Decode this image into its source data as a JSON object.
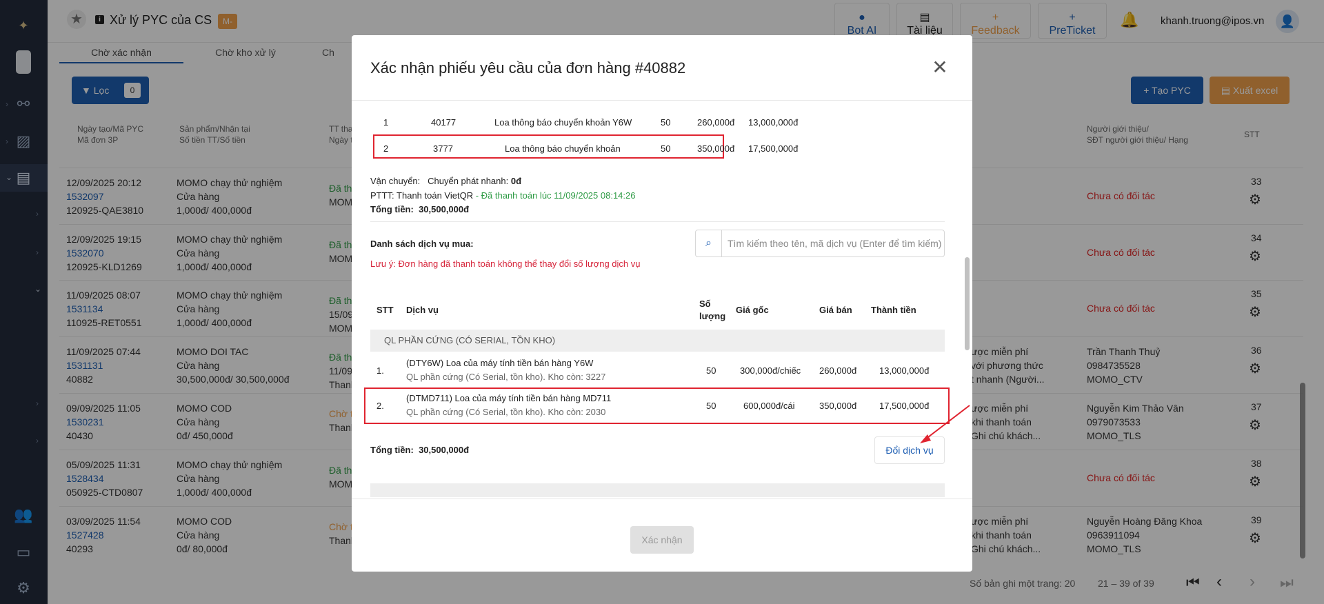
{
  "app": {
    "title": "Xử lý PYC của CS",
    "badge": "M-"
  },
  "topbar": {
    "bot_ai": "Bot AI",
    "tai_lieu": "Tài liệu",
    "feedback": "Feedback",
    "preticket": "PreTicket",
    "user_email": "khanh.truong@ipos.vn"
  },
  "tabs": [
    "Chờ xác nhận",
    "Chờ kho xử lý",
    "Ch"
  ],
  "filter": {
    "label": "Lọc",
    "count": "0"
  },
  "actions": {
    "create": "+ Tạo PYC",
    "excel": "Xuất excel"
  },
  "table": {
    "headers": {
      "col1": "Ngày tạo/Mã PYC\nMã đơn 3P",
      "col2": "Sản phẩm/Nhận tại\nSố tiền TT/Số tiền",
      "col3": "TT tha\nNgày t",
      "col4": "Người giới thiệu/\nSĐT người giới thiệu/ Hạng",
      "stt": "STT"
    },
    "rows": [
      {
        "date": "12/09/2025 20:12",
        "code": "1532097",
        "order": "120925-QAE3810",
        "product": "MOMO chạy thử nghiệm",
        "place": "Cửa hàng",
        "amount": "1,000đ/ 400,000đ",
        "status": "Đã th",
        "status2": "MOM",
        "ref1": "Chưa có đối tác",
        "ref2": "",
        "ref3": "",
        "note1": "",
        "note2": "",
        "note3": "",
        "stt": "33"
      },
      {
        "date": "12/09/2025 19:15",
        "code": "1532070",
        "order": "120925-KLD1269",
        "product": "MOMO chạy thử nghiệm",
        "place": "Cửa hàng",
        "amount": "1,000đ/ 400,000đ",
        "status": "Đã th",
        "status2": "MOM",
        "ref1": "Chưa có đối tác",
        "ref2": "",
        "ref3": "",
        "note1": "",
        "note2": "",
        "note3": "",
        "stt": "34"
      },
      {
        "date": "11/09/2025 08:07",
        "code": "1531134",
        "order": "110925-RET0551",
        "product": "MOMO chạy thử nghiệm",
        "place": "Cửa hàng",
        "amount": "1,000đ/ 400,000đ",
        "status": "Đã th",
        "status2": "15/09",
        "status3": "MOM",
        "ref1": "Chưa có đối tác",
        "ref2": "",
        "ref3": "",
        "note1": "",
        "note2": "",
        "note3": "",
        "stt": "35"
      },
      {
        "date": "11/09/2025 07:44",
        "code": "1531131",
        "order": "40882",
        "product": "MOMO DOI TAC",
        "place": "Cửa hàng",
        "amount": "30,500,000đ/ 30,500,000đ",
        "status": "Đã th",
        "status2": "11/09",
        "status3": "Thanh",
        "ref1": "Trần Thanh Thuỷ",
        "ref2": "0984735528",
        "ref3": "MOMO_CTV",
        "note1": "ược miễn phí",
        "note2": "với phương thức",
        "note3": "t nhanh (Người...",
        "stt": "36"
      },
      {
        "date": "09/09/2025 11:05",
        "code": "1530231",
        "order": "40430",
        "product": "MOMO COD",
        "place": "Cửa hàng",
        "amount": "0đ/ 450,000đ",
        "status": "Chờ t",
        "status2": "Thanh",
        "ref1": "Nguyễn Kim Thảo Vân",
        "ref2": "0979073533",
        "ref3": "MOMO_TLS",
        "note1": "ược miễn phí",
        "note2": "khi thanh toán",
        "note3": "Ghi chú khách...",
        "stt": "37"
      },
      {
        "date": "05/09/2025 11:31",
        "code": "1528434",
        "order": "050925-CTD0807",
        "product": "MOMO chạy thử nghiệm",
        "place": "Cửa hàng",
        "amount": "1,000đ/ 400,000đ",
        "status": "Đã th",
        "status2": "MOM",
        "ref1": "Chưa có đối tác",
        "ref2": "",
        "ref3": "",
        "note1": "",
        "note2": "",
        "note3": "",
        "stt": "38"
      },
      {
        "date": "03/09/2025 11:54",
        "code": "1527428",
        "order": "40293",
        "product": "MOMO COD",
        "place": "Cửa hàng",
        "amount": "0đ/ 80,000đ",
        "status": "Chờ t",
        "status2": "Thanh",
        "ref1": "Nguyễn Hoàng Đăng Khoa",
        "ref2": "0963911094",
        "ref3": "MOMO_TLS",
        "note1": "ược miễn phí",
        "note2": "khi thanh toán",
        "note3": "Ghi chú khách...",
        "stt": "39"
      }
    ]
  },
  "pager": {
    "per_page": "Số bản ghi một trang: 20",
    "range": "21 – 39 of 39"
  },
  "modal": {
    "title": "Xác nhận phiếu yêu cầu của đơn hàng #40882",
    "top_rows": [
      {
        "idx": "1",
        "code": "40177",
        "name": "Loa thông báo chuyển khoản Y6W",
        "qty": "50",
        "price": "260,000đ",
        "total": "13,000,000đ"
      },
      {
        "idx": "2",
        "code": "3777",
        "name": "Loa thông báo chuyển khoản",
        "qty": "50",
        "price": "350,000đ",
        "total": "17,500,000đ"
      }
    ],
    "shipping_label": "Vận chuyển:",
    "shipping_value": "Chuyển phát nhanh:",
    "shipping_fee": "0đ",
    "payment_label": "PTTT: Thanh toán VietQR",
    "payment_status": " - Đã thanh toán lúc 11/09/2025 08:14:26",
    "total_label": "Tổng tiền:",
    "total_value": "30,500,000đ",
    "services_label": "Danh sách dịch vụ mua:",
    "services_note": "Lưu ý: Đơn hàng đã thanh toán không thể thay đổi số lượng dịch vụ",
    "search_placeholder": "Tìm kiếm theo tên, mã dịch vụ (Enter để tìm kiếm)",
    "headers": {
      "stt": "STT",
      "service": "Dịch vụ",
      "qty1": "Số",
      "qty2": "lượng",
      "orig": "Giá gốc",
      "sale": "Giá bán",
      "total": "Thành tiền"
    },
    "group": "QL PHẦN CỨNG (CÓ SERIAL, TỒN KHO)",
    "items": [
      {
        "idx": "1.",
        "name": "(DTY6W) Loa của máy tính tiền bán hàng Y6W",
        "sub": "QL phần cứng (Có Serial, tồn kho). Kho còn: 3227",
        "qty": "50",
        "orig": "300,000đ/chiếc",
        "sale": "260,000đ",
        "total": "13,000,000đ"
      },
      {
        "idx": "2.",
        "name": "(DTMD711) Loa của máy tính tiền bán hàng MD711",
        "sub": "QL phần cứng (Có Serial, tồn kho). Kho còn: 2030",
        "qty": "50",
        "orig": "600,000đ/cái",
        "sale": "350,000đ",
        "total": "17,500,000đ"
      }
    ],
    "change_button": "Đổi dịch vụ",
    "confirm_button": "Xác nhận",
    "colors": {
      "accent": "#1f5fb3",
      "highlight": "#e02430",
      "paid": "#2e9b45"
    }
  }
}
